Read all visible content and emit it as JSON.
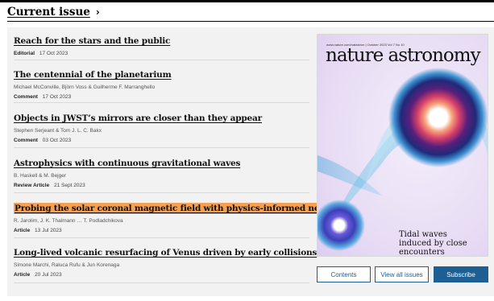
{
  "section": {
    "title": "Current issue",
    "chevron": "›"
  },
  "articles": [
    {
      "title": "Reach for the stars and the public",
      "authors": "",
      "type": "Editorial",
      "date": "17 Oct 2023",
      "highlighted": false
    },
    {
      "title": "The centennial of the planetarium",
      "authors": "Michael McConville, Björn Voss & Guilherme F. Marranghello",
      "type": "Comment",
      "date": "17 Oct 2023",
      "highlighted": false
    },
    {
      "title": "Objects in JWST’s mirrors are closer than they appear",
      "authors": "Stephen Serjeant & Tom J. L. C. Bakx",
      "type": "Comment",
      "date": "03 Oct 2023",
      "highlighted": false
    },
    {
      "title": "Astrophysics with continuous gravitational waves",
      "authors": "B. Haskell & M. Bejger",
      "type": "Review Article",
      "date": "21 Sept 2023",
      "highlighted": false
    },
    {
      "title": "Probing the solar coronal magnetic field with physics-informed neural networks",
      "authors": "R. Jarolim, J. K. Thalmann … T. Podladchikova",
      "type": "Article",
      "date": "13 Jul 2023",
      "highlighted": true
    },
    {
      "title": "Long-lived volcanic resurfacing of Venus driven by early collisions",
      "authors": "Simone Marchi, Raluca Rufu & Jun Korenaga",
      "type": "Article",
      "date": "20 Jul 2023",
      "highlighted": false
    }
  ],
  "cover": {
    "masthead_small": "www.nature.com/natastron | October 2023 Vol 7 No 10",
    "title": "nature astronomy",
    "caption": "Tidal waves induced by close encounters"
  },
  "buttons": {
    "contents": "Contents",
    "view_all": "View all issues",
    "subscribe": "Subscribe"
  },
  "colors": {
    "highlight": "#f5a052",
    "button_blue": "#1d5f93",
    "panel_bg": "#f2f2f2"
  }
}
